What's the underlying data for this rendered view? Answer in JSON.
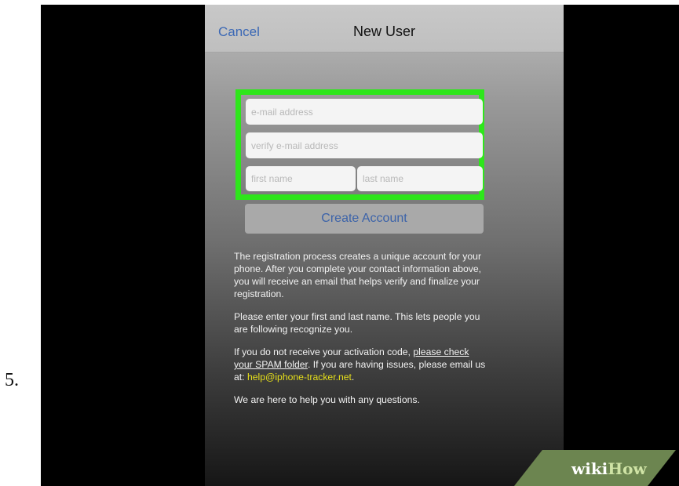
{
  "step_number": "5.",
  "navbar": {
    "cancel_label": "Cancel",
    "title": "New User"
  },
  "form": {
    "email_placeholder": "e-mail address",
    "verify_email_placeholder": "verify e-mail address",
    "first_name_placeholder": "first name",
    "last_name_placeholder": "last name",
    "create_button_label": "Create Account",
    "highlight_color": "#2ee61b"
  },
  "info": {
    "paragraph1": " The registration process creates a unique account for your phone. After you complete your contact information above, you will receive an email that helps verify and finalize your registration.",
    "paragraph2": "Please enter your first and last name. This lets people you are following recognize you.",
    "paragraph3_prefix": "If you do not receive your activation code, ",
    "paragraph3_link": "please check your SPAM folder",
    "paragraph3_middle": ". If you are having issues, please email us at: ",
    "support_email": "help@iphone-tracker.net",
    "paragraph3_suffix": ".",
    "paragraph4": "We are here to help you with any questions."
  },
  "watermark": {
    "wiki": "wiki",
    "how": "How"
  },
  "colors": {
    "link_blue": "#3b68b5",
    "email_yellow": "#e6df1a",
    "wikihow_green": "#6c8550"
  }
}
